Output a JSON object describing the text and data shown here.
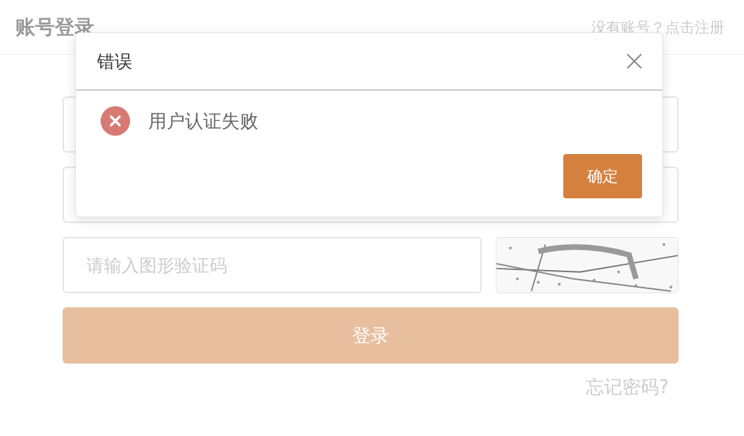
{
  "header": {
    "title": "账号登录",
    "register_link": "没有账号？点击注册"
  },
  "form": {
    "fields": [
      {
        "kind": "text"
      },
      {
        "kind": "text"
      },
      {
        "kind": "captcha",
        "placeholder": "请输入图形验证码"
      }
    ],
    "submit": "登录",
    "forgot_link": "忘记密码?"
  },
  "dialog": {
    "title": "错误",
    "message": "用户认证失败",
    "kind": "error",
    "confirm": "确定"
  }
}
